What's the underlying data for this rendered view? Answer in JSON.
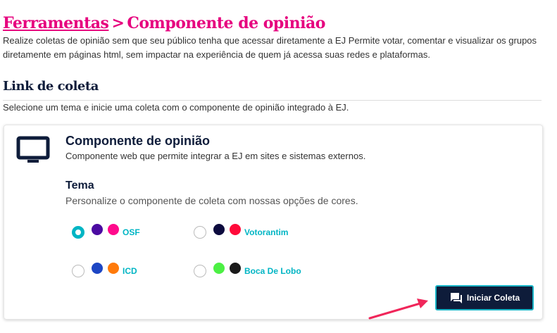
{
  "header": {
    "crumb": "Ferramentas",
    "separator": ">",
    "current": "Componente de opinião",
    "description": "Realize coletas de opinião sem que seu público tenha que acessar diretamente a EJ Permite votar, comentar e visualizar os grupos diretamente em páginas html, sem impactar na experiência de quem já acessa suas redes e plataformas."
  },
  "section": {
    "title": "Link de coleta",
    "description": "Selecione um tema e inicie uma coleta com o componente de opinião integrado à EJ."
  },
  "card": {
    "icon": "monitor-icon",
    "title": "Componente de opinião",
    "subtitle": "Componente web que permite integrar a EJ em sites e sistemas externos.",
    "theme_title": "Tema",
    "theme_subtitle": "Personalize o componente de coleta com nossas opções de cores.",
    "options": [
      {
        "label": "OSF",
        "selected": true,
        "colors": [
          "#4b0aa1",
          "#ff0a8c"
        ]
      },
      {
        "label": "Votorantim",
        "selected": false,
        "colors": [
          "#0c0a3e",
          "#ff0a3a"
        ]
      },
      {
        "label": "ICD",
        "selected": false,
        "colors": [
          "#1d46c4",
          "#ff7a0a"
        ]
      },
      {
        "label": "Boca De Lobo",
        "selected": false,
        "colors": [
          "#4cf044",
          "#1a1a1a"
        ]
      }
    ],
    "button_label": "Iniciar Coleta",
    "button_icon": "chat-icon"
  }
}
